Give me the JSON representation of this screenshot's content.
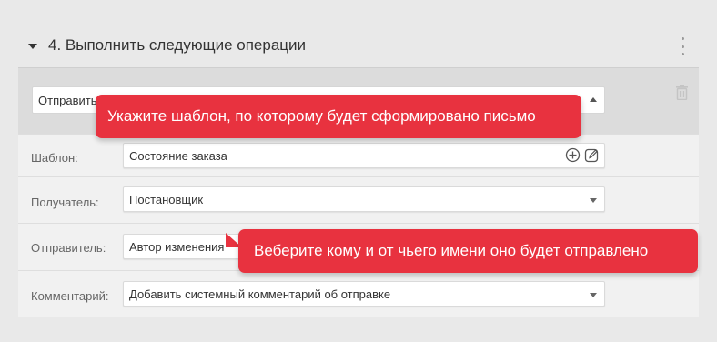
{
  "section": {
    "title": "4. Выполнить следующие операции"
  },
  "action": {
    "value": "Отправить"
  },
  "fields": {
    "template": {
      "label": "Шаблон:",
      "value": "Состояние заказа"
    },
    "recipient": {
      "label": "Получатель:",
      "value": "Постановщик"
    },
    "sender": {
      "label": "Отправитель:",
      "value": "Автор изменения"
    },
    "comment": {
      "label": "Комментарий:",
      "value": "Добавить системный комментарий об отправке"
    }
  },
  "tooltips": {
    "template_hint": "Укажите шаблон, по которому будет сформировано письмо",
    "recipient_hint": "Веберите кому и от чьего имени оно будет отправлено"
  },
  "colors": {
    "accent": "#e8323f",
    "background": "#e9e9e9"
  },
  "icons": [
    "collapse-arrow-icon",
    "kebab-menu-icon",
    "trash-icon",
    "add-circle-icon",
    "edit-icon",
    "caret-down-icon",
    "caret-up-icon"
  ]
}
